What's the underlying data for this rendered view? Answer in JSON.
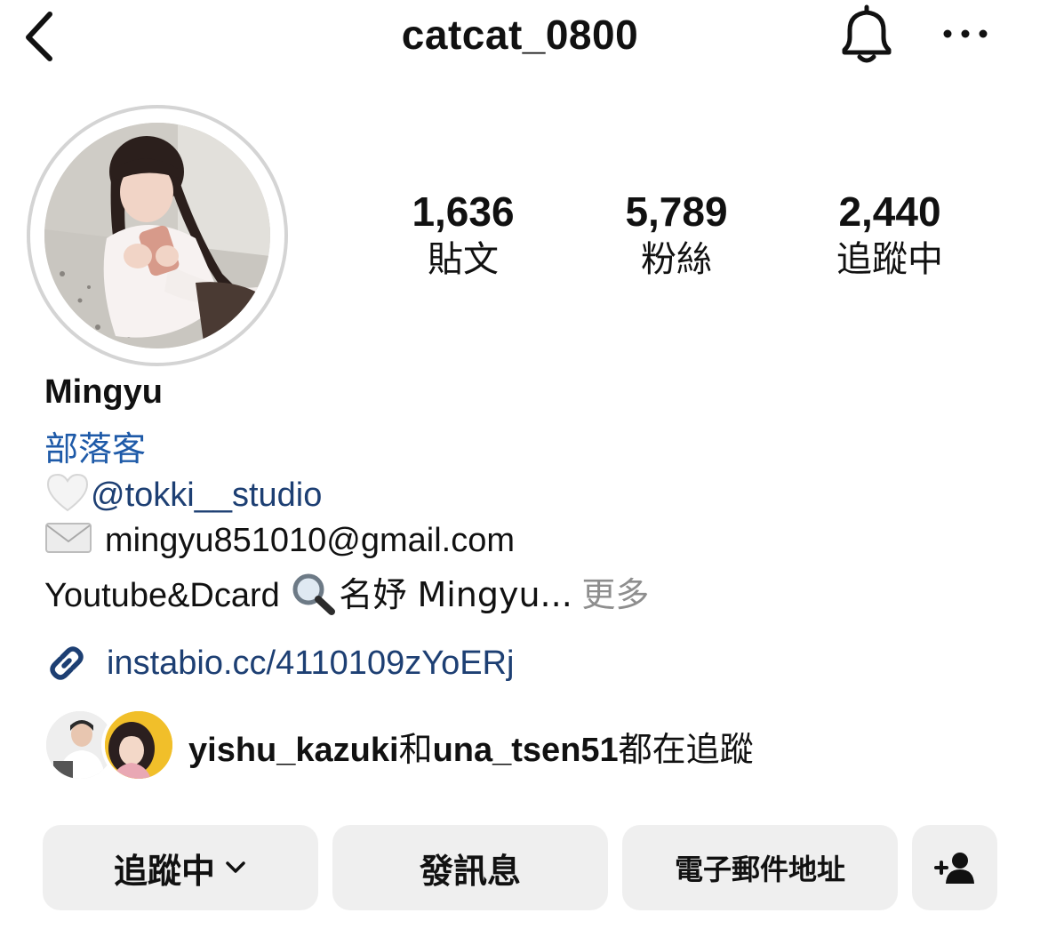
{
  "header": {
    "username": "catcat_0800",
    "back_icon": "chevron-left-icon",
    "bell_icon": "bell-icon",
    "more_icon": "more-horizontal-icon"
  },
  "profile": {
    "stats": [
      {
        "value": "1,636",
        "label": "貼文"
      },
      {
        "value": "5,789",
        "label": "粉絲"
      },
      {
        "value": "2,440",
        "label": "追蹤中"
      }
    ],
    "display_name": "Mingyu",
    "category": "部落客",
    "bio": {
      "line1_mention": "@tokki__studio",
      "line2_email": "mingyu851010@gmail.com",
      "line3_text": "Youtube&Dcard",
      "line3_search": "名妤 Mingyu...",
      "more_label": "更多"
    },
    "link": "instabio.cc/4110109zYoERj"
  },
  "followed_by": {
    "user1": "yishu_kazuki",
    "connector": "和",
    "user2": "una_tsen51",
    "suffix": "都在追蹤"
  },
  "actions": {
    "following_label": "追蹤中",
    "message_label": "發訊息",
    "email_label": "電子郵件地址",
    "add_user_icon": "add-user-icon"
  },
  "colors": {
    "link_blue": "#1d3f73",
    "category_blue": "#1e5aa8",
    "button_bg": "#efefef",
    "muted_gray": "#8e8e8e"
  }
}
